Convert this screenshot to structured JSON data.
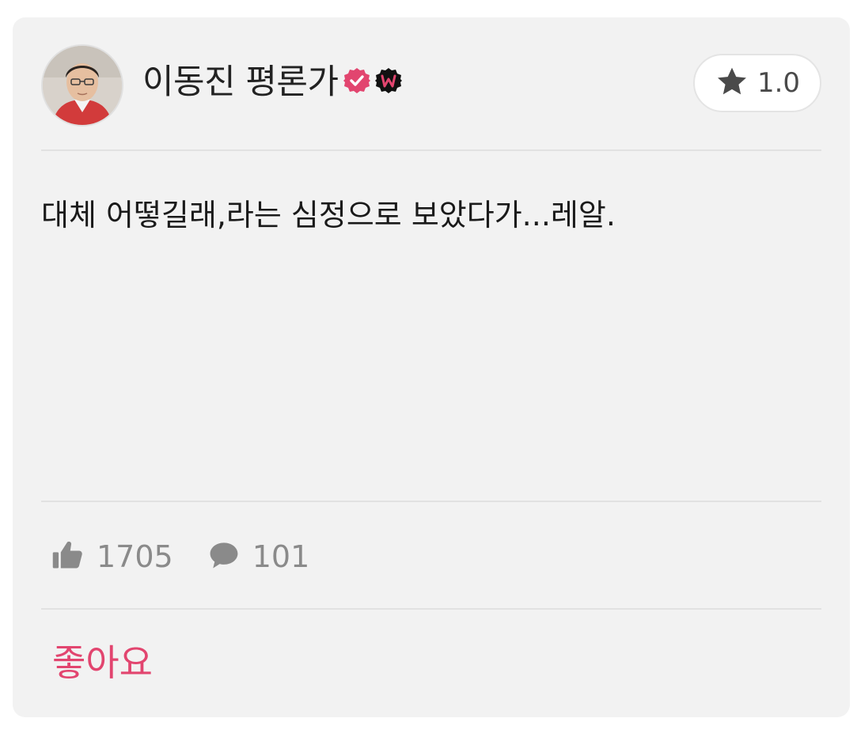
{
  "review": {
    "author_name": "이동진 평론가",
    "rating": "1.0",
    "comment": "대체 어떻길래,라는 심정으로 보았다가...레알.",
    "likes_count": "1705",
    "comments_count": "101",
    "like_button_label": "좋아요"
  },
  "icons": {
    "avatar": "critic-profile-photo",
    "verified": "verified-check-icon",
    "watcha_badge": "watcha-w-badge-icon",
    "star": "star-icon",
    "thumbs_up": "thumbs-up-icon",
    "comment": "comment-bubble-icon"
  },
  "colors": {
    "card_background": "#f2f2f2",
    "accent": "#e2456f",
    "muted": "#8a8a8a",
    "text": "#1a1a1a"
  }
}
